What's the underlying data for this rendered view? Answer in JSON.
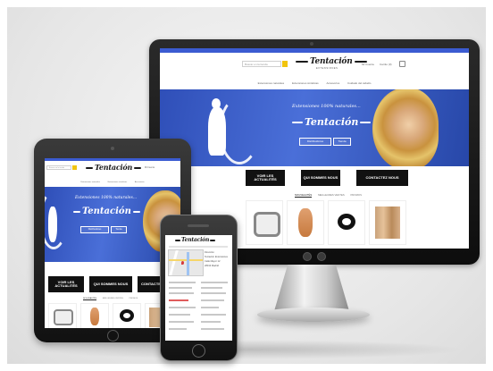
{
  "site": {
    "brand": "Tentación",
    "brand_sub": "EXTENSIONES",
    "search_placeholder": "Buscar en la tienda",
    "header_links": [
      "Mi Cuenta",
      "Carrito (0)"
    ],
    "menu": [
      "Extensiones naturales",
      "Extensiones sintéticas",
      "Accesorios",
      "Cuidado del cabello"
    ],
    "hero": {
      "tagline": "Extensiones 100% naturales...",
      "brand": "Tentación",
      "buttons": [
        "Distribuidores",
        "Tienda"
      ]
    },
    "blocks": [
      {
        "line1": "VOIR LES",
        "line2": "ACTUALITÉS"
      },
      {
        "line1": "QUI SOMMES NOUS",
        "line2": ""
      },
      {
        "line1": "CONTACTEZ NOUS",
        "line2": ""
      }
    ],
    "tabs": [
      "NOUVEAUTÉS",
      "MEILLEURES VENTES",
      "PROMOS"
    ],
    "phone_footer": [
      "Dirección",
      "Tentación Extensiones",
      "Calle Mayor 12",
      "28013 Madrid"
    ]
  },
  "colors": {
    "accent_blue": "#3b5bd1",
    "search_yellow": "#f1c40f",
    "black_block": "#111111"
  }
}
